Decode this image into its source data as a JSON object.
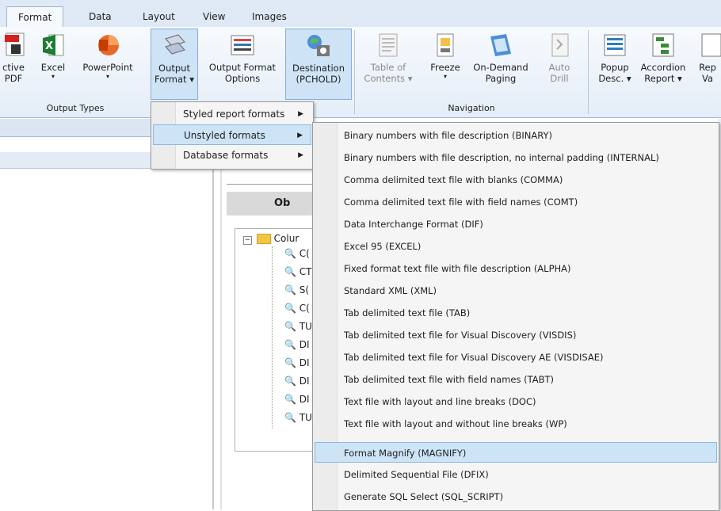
{
  "tabs": [
    "Format",
    "Data",
    "Layout",
    "View",
    "Images"
  ],
  "active_tab": "Format",
  "ribbon": {
    "output_types": {
      "label": "Output Types",
      "buttons": [
        {
          "label1": "ctive",
          "label2": "PDF"
        },
        {
          "label1": "Excel",
          "label2": "▾"
        },
        {
          "label1": "PowerPoint",
          "label2": "▾"
        },
        {
          "label1": "Output",
          "label2": "Format ▾"
        },
        {
          "label1": "Output Format",
          "label2": "Options"
        },
        {
          "label1": "Destination",
          "label2": "(PCHOLD)"
        }
      ]
    },
    "navigation": {
      "label": "Navigation",
      "buttons": [
        {
          "label1": "Table of",
          "label2": "Contents ▾"
        },
        {
          "label1": "Freeze",
          "label2": "▾"
        },
        {
          "label1": "On-Demand",
          "label2": "Paging"
        },
        {
          "label1": "Auto",
          "label2": "Drill"
        }
      ]
    },
    "right_group": {
      "buttons": [
        {
          "label1": "Popup",
          "label2": "Desc. ▾"
        },
        {
          "label1": "Accordion",
          "label2": "Report ▾"
        },
        {
          "label1": "Rep",
          "label2": "Va"
        }
      ]
    }
  },
  "center": {
    "header": "Ob",
    "tree_root": "Colur",
    "tree_items": [
      "C(",
      "CT",
      "S(",
      "C(",
      "TU",
      "DI",
      "DI",
      "DI",
      "DI",
      "TU"
    ]
  },
  "menu1": [
    {
      "label": "Styled report formats"
    },
    {
      "label": "Unstyled formats"
    },
    {
      "label": "Database formats"
    }
  ],
  "menu2": [
    "Binary numbers with file description (BINARY)",
    "Binary numbers with file description, no internal padding (INTERNAL)",
    "Comma delimited text file with blanks (COMMA)",
    "Comma delimited text file with field names (COMT)",
    "Data Interchange Format (DIF)",
    "Excel 95 (EXCEL)",
    "Fixed format text file with file description (ALPHA)",
    "Standard XML (XML)",
    "Tab delimited text file (TAB)",
    "Tab delimited text file for Visual Discovery (VISDIS)",
    "Tab delimited text file for Visual Discovery AE (VISDISAE)",
    "Tab delimited text file with field names (TABT)",
    "Text file with layout and line breaks (DOC)",
    "Text file with layout and without line breaks (WP)",
    "Format Magnify (MAGNIFY)",
    "Delimited Sequential File (DFIX)",
    "Generate SQL Select (SQL_SCRIPT)"
  ],
  "highlighted_submenu_item": "Format Magnify (MAGNIFY)"
}
